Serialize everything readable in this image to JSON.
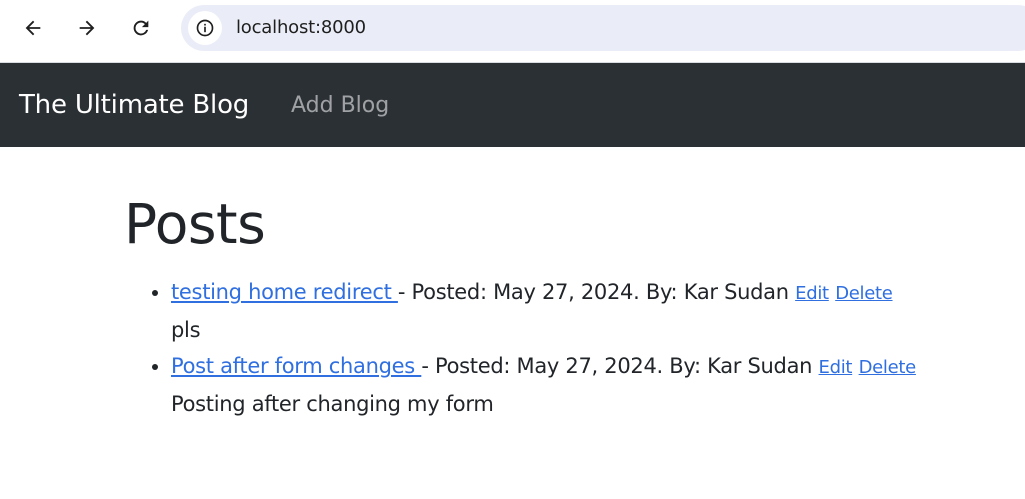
{
  "browser": {
    "url": "localhost:8000",
    "icons": {
      "back": "arrow-left-icon",
      "forward": "arrow-right-icon",
      "reload": "reload-icon",
      "site_info": "info-icon"
    }
  },
  "navbar": {
    "brand": "The Ultimate Blog",
    "links": [
      {
        "label": "Add Blog"
      }
    ],
    "background": "#2b3035"
  },
  "main": {
    "title": "Posts",
    "posts": [
      {
        "title": "testing home redirect ",
        "meta": " - Posted: May 27, 2024. By: Kar Sudan ",
        "edit_label": "Edit",
        "delete_label": "Delete",
        "body": "pls"
      },
      {
        "title": "Post after form changes ",
        "meta": " - Posted: May 27, 2024. By: Kar Sudan ",
        "edit_label": "Edit",
        "delete_label": "Delete",
        "body": "Posting after changing my form"
      }
    ]
  },
  "colors": {
    "link": "#2f6fe0",
    "text": "#212529"
  }
}
